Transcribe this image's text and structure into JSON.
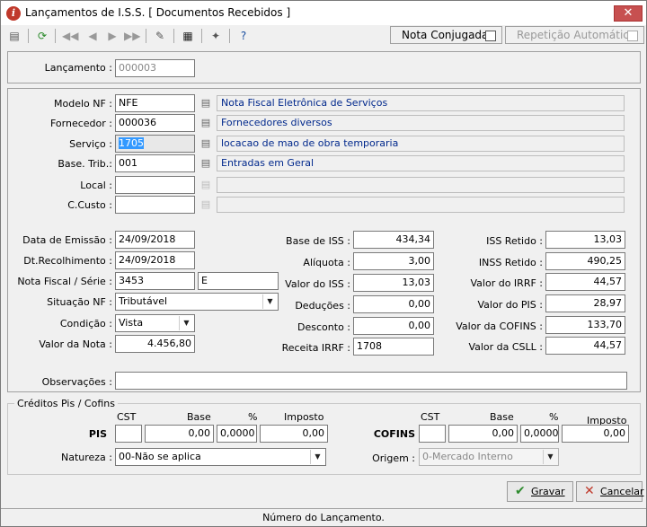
{
  "window": {
    "title": "Lançamentos de I.S.S. [ Documentos Recebidos ]",
    "close": "✕"
  },
  "toolbar": {
    "nota_conjugada": "Nota Conjugada",
    "repeticao": "Repetição Automática"
  },
  "lancamento": {
    "label": "Lançamento :",
    "value": "000003"
  },
  "fields": {
    "modelo": {
      "label": "Modelo NF :",
      "value": "NFE",
      "desc": "Nota Fiscal Eletrônica de Serviços"
    },
    "fornecedor": {
      "label": "Fornecedor :",
      "value": "000036",
      "desc": "Fornecedores diversos"
    },
    "servico": {
      "label": "Serviço :",
      "value": "1705",
      "desc": "locacao de mao de obra temporaria"
    },
    "base_trib": {
      "label": "Base. Trib.:",
      "value": "001",
      "desc": "Entradas em Geral"
    },
    "local": {
      "label": "Local :",
      "value": "",
      "desc": ""
    },
    "ccusto": {
      "label": "C.Custo :",
      "value": "",
      "desc": ""
    }
  },
  "left": {
    "data_emissao": {
      "label": "Data de Emissão :",
      "value": "24/09/2018"
    },
    "dt_recolhimento": {
      "label": "Dt.Recolhimento :",
      "value": "24/09/2018"
    },
    "nota_serie": {
      "label": "Nota Fiscal / Série :",
      "value": "3453",
      "serie": "E"
    },
    "situacao": {
      "label": "Situação NF :",
      "value": "Tributável"
    },
    "condicao": {
      "label": "Condição :",
      "value": "Vista"
    },
    "valor_nota": {
      "label": "Valor da Nota :",
      "value": "4.456,80"
    }
  },
  "mid": {
    "base_iss": {
      "label": "Base de ISS :",
      "value": "434,34"
    },
    "aliquota": {
      "label": "Alíquota :",
      "value": "3,00"
    },
    "valor_iss": {
      "label": "Valor do ISS :",
      "value": "13,03"
    },
    "deducoes": {
      "label": "Deduções :",
      "value": "0,00"
    },
    "desconto": {
      "label": "Desconto :",
      "value": "0,00"
    },
    "receita_irrf": {
      "label": "Receita IRRF :",
      "value": "1708"
    }
  },
  "right": {
    "iss_retido": {
      "label": "ISS Retido :",
      "value": "13,03"
    },
    "inss_retido": {
      "label": "INSS Retido :",
      "value": "490,25"
    },
    "valor_irrf": {
      "label": "Valor do IRRF :",
      "value": "44,57"
    },
    "valor_pis": {
      "label": "Valor do PIS :",
      "value": "28,97"
    },
    "valor_cofins": {
      "label": "Valor da COFINS :",
      "value": "133,70"
    },
    "valor_csll": {
      "label": "Valor da CSLL :",
      "value": "44,57"
    }
  },
  "observacoes": {
    "label": "Observações :",
    "value": ""
  },
  "creditos": {
    "legend": "Créditos Pis / Cofins",
    "headers": {
      "cst": "CST",
      "base": "Base",
      "pct": "%",
      "imposto": "Imposto"
    },
    "pis": {
      "label": "PIS",
      "cst": "",
      "base": "0,00",
      "pct": "0,0000",
      "imposto": "0,00"
    },
    "cofins": {
      "label": "COFINS",
      "cst": "",
      "base": "0,00",
      "pct": "0,0000",
      "imposto": "0,00"
    },
    "natureza": {
      "label": "Natureza :",
      "value": "00-Não se aplica"
    },
    "origem": {
      "label": "Origem :",
      "value": "0-Mercado Interno"
    }
  },
  "buttons": {
    "gravar": "Gravar",
    "cancelar": "Cancelar"
  },
  "status": "Número do Lançamento."
}
